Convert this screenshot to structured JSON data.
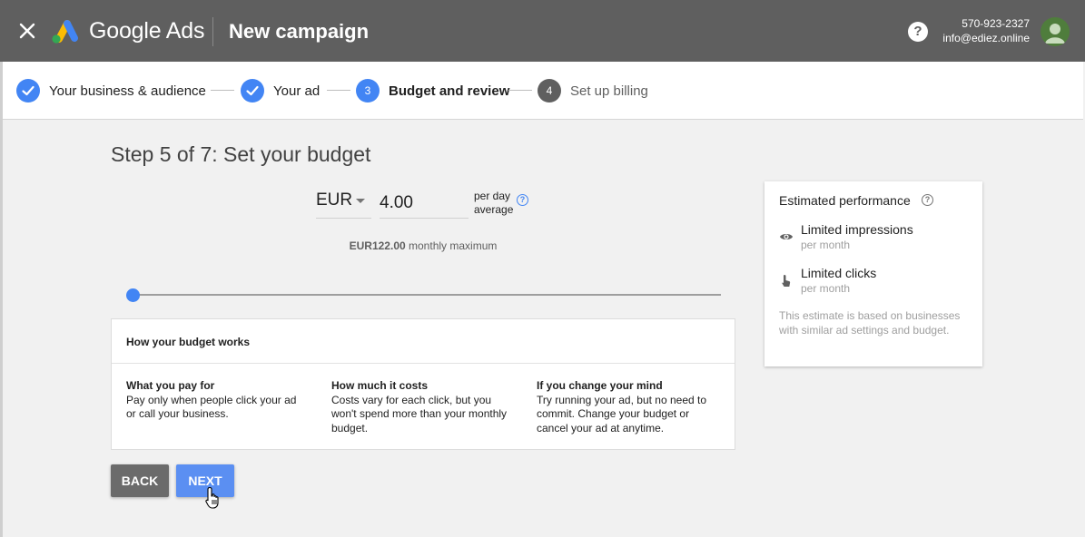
{
  "header": {
    "brand": "Google Ads",
    "page_title": "New campaign",
    "phone": "570-923-2327",
    "email": "info@ediez.online",
    "help_glyph": "?"
  },
  "stepper": {
    "steps": [
      {
        "label": "Your business & audience",
        "state": "done"
      },
      {
        "label": "Your ad",
        "state": "done"
      },
      {
        "label": "Budget and review",
        "state": "active",
        "number": "3"
      },
      {
        "label": "Set up billing",
        "state": "pending",
        "number": "4"
      }
    ]
  },
  "budget": {
    "step_title": "Step 5 of 7: Set your budget",
    "currency": "EUR",
    "amount": "4.00",
    "per_day": "per day",
    "average": "average",
    "monthly_amount": "EUR122.00",
    "monthly_label": "monthly maximum",
    "slider_value_fraction": 0.0
  },
  "info": {
    "heading": "How your budget works",
    "columns": [
      {
        "title": "What you pay for",
        "body": "Pay only when people click your ad or call your business."
      },
      {
        "title": "How much it costs",
        "body": "Costs vary for each click, but you won't spend more than your monthly budget."
      },
      {
        "title": "If you change your mind",
        "body": "Try running your ad, but no need to commit. Change your budget or cancel your ad at anytime."
      }
    ]
  },
  "buttons": {
    "back": "BACK",
    "next": "NEXT"
  },
  "performance": {
    "title": "Estimated performance",
    "impressions": "Limited impressions",
    "impressions_sub": "per month",
    "clicks": "Limited clicks",
    "clicks_sub": "per month",
    "note": "This estimate is based on businesses with similar ad settings and budget."
  },
  "colors": {
    "topbar": "#5f5f5f",
    "accent": "#4285f4",
    "next_button": "#5b8ff2",
    "back_button": "#6b6b6b"
  }
}
